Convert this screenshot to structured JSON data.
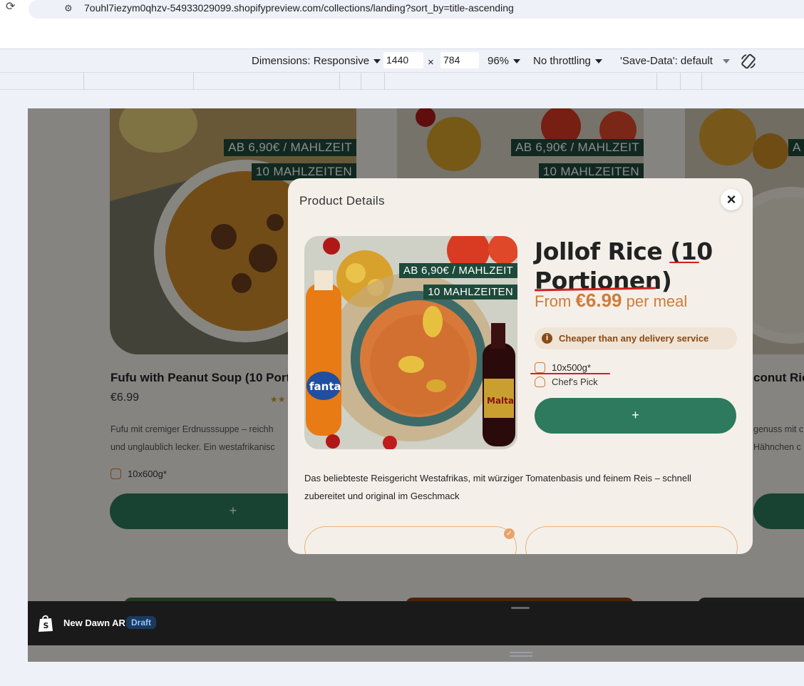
{
  "browser": {
    "url": "7ouhl7iezym0qhzv-54933029099.shopifypreview.com/collections/landing?sort_by=title-ascending"
  },
  "devtools": {
    "dimensions_label": "Dimensions: Responsive",
    "width": "1440",
    "times": "×",
    "height": "784",
    "zoom": "96%",
    "throttling": "No throttling",
    "save_data": "'Save-Data': default"
  },
  "cards": [
    {
      "tag_price": "AB 6,90€ / MAHLZEIT",
      "tag_count": "10 MAHLZEITEN",
      "title": "Fufu with Peanut Soup (10 Port",
      "price": "€6.99",
      "desc_line1": "Fufu mit cremiger Erdnusssuppe – reichh",
      "desc_line2": "und unglaublich lecker. Ein westafrikanisc",
      "weight": "10x600g*",
      "button": "+"
    },
    {
      "tag_price": "AB 6,90€ / MAHLZEIT",
      "tag_count": "10 MAHLZEITEN"
    },
    {
      "tag_price": "A",
      "title": "conut Ric",
      "desc_line1": "genuss mit c",
      "desc_line2": "Hähnchen c"
    }
  ],
  "shopify": {
    "store_name": "New Dawn AR",
    "status": "Draft"
  },
  "modal": {
    "title": "Product Details",
    "close": "×",
    "product_name": "Jollof Rice (10 Portionen)",
    "tag_price": "AB 6,90€ / MAHLZEIT",
    "tag_count": "10 MAHLZEITEN",
    "price_prefix": "From",
    "price_value": "€6.99",
    "price_suffix": "per meal",
    "notice_icon": "i",
    "notice": "Cheaper than any delivery service",
    "weight": "10x500g*",
    "badge": "Chef's Pick",
    "add_button": "+",
    "description": "Das beliebteste Reisgericht Westafrikas, mit würziger Tomatenbasis und feinem Reis – schnell zubereitet und original im Geschmack",
    "option_check": "✓"
  },
  "colors": {
    "brand_green": "#2d7a5e",
    "tag_green": "#1e4a3b",
    "price_orange": "#d07a3a",
    "notice_brown": "#8a4a16",
    "annotation_red": "#d02020"
  }
}
